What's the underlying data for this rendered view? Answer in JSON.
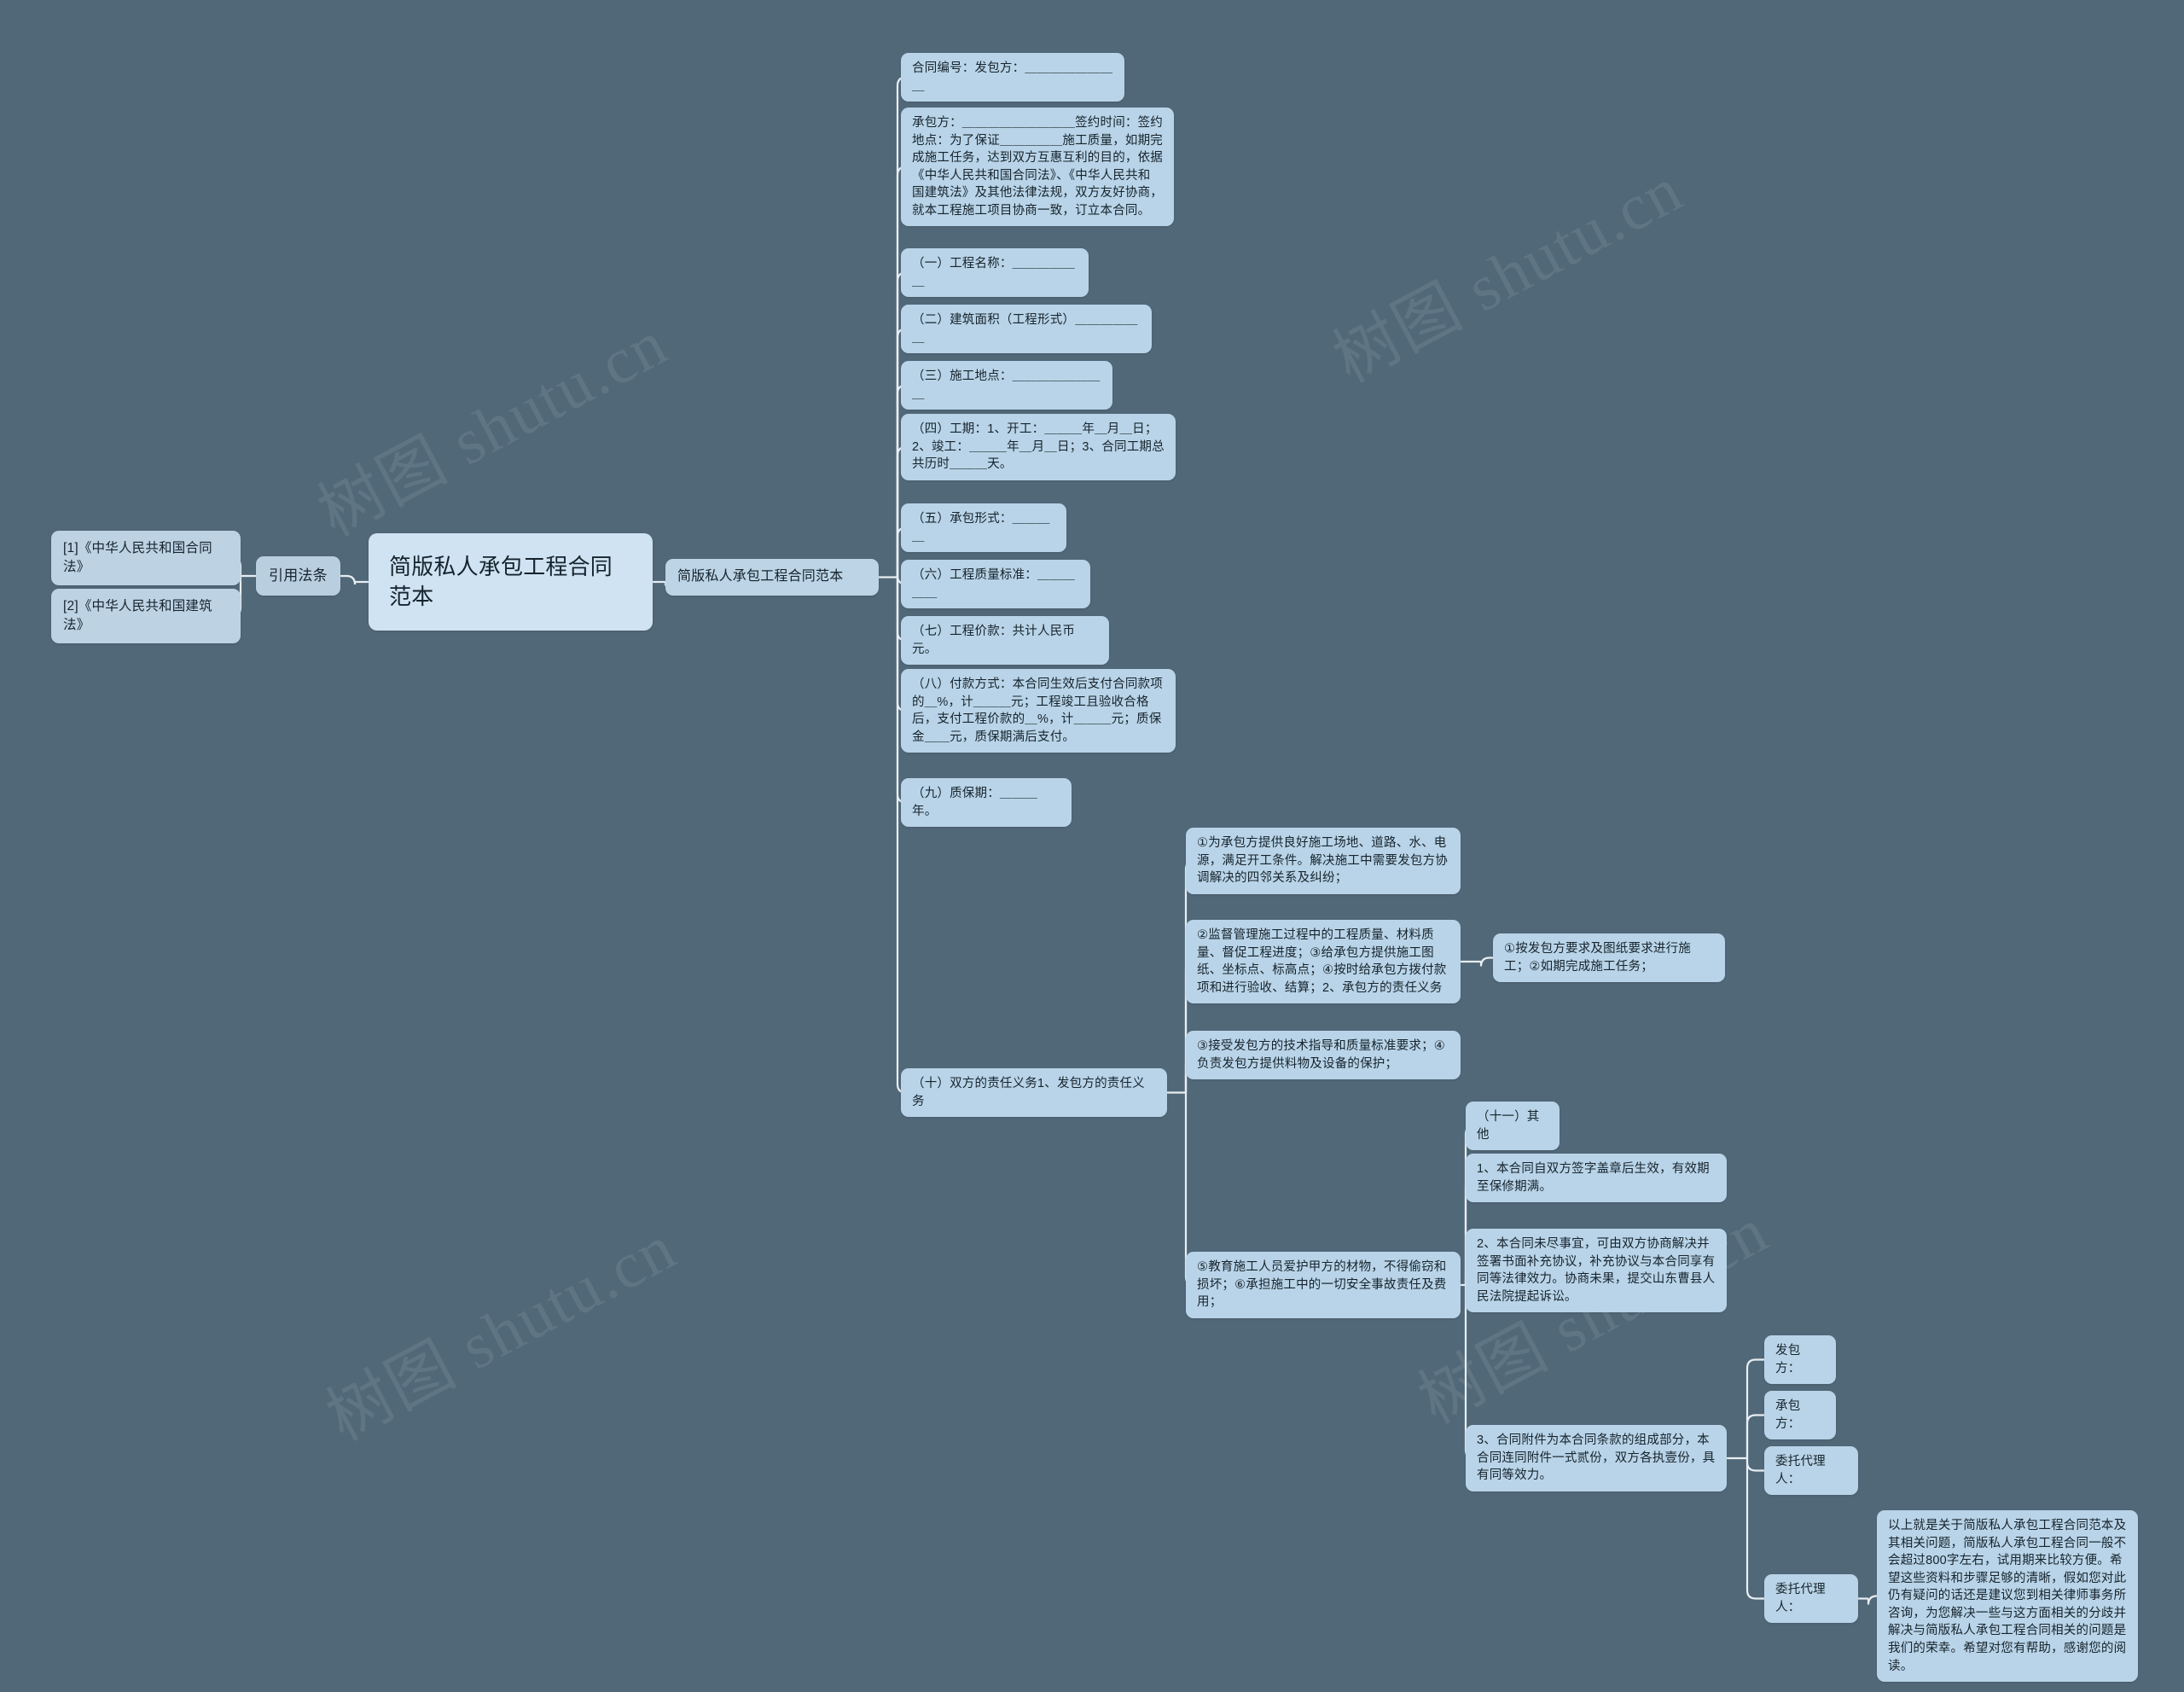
{
  "meta": {
    "background_color": "#516879",
    "node_color": "#b9d4e8",
    "root_node_color": "#cfe3f2",
    "link_color": "#e8eef2",
    "text_color": "#16232c",
    "watermark_text": "树图 shutu.cn"
  },
  "root": {
    "label": "简版私人承包工程合同范本"
  },
  "left_branch": {
    "label": "引用法条",
    "references": [
      {
        "label": "[1]《中华人民共和国合同法》"
      },
      {
        "label": "[2]《中华人民共和国建筑法》"
      }
    ]
  },
  "main_branch": {
    "label": "简版私人承包工程合同范本",
    "clauses": [
      {
        "id": "c0",
        "label": "合同编号：发包方：＿＿＿＿＿＿＿＿"
      },
      {
        "id": "c1",
        "label": "承包方：＿＿＿＿＿＿＿＿＿签约时间：签约地点：为了保证＿＿＿＿＿施工质量，如期完成施工任务，达到双方互惠互利的目的，依据《中华人民共和国合同法》、《中华人民共和国建筑法》及其他法律法规，双方友好协商，就本工程施工项目协商一致，订立本合同。"
      },
      {
        "id": "c2",
        "label": "（一）工程名称：＿＿＿＿＿＿"
      },
      {
        "id": "c3",
        "label": "（二）建筑面积（工程形式）＿＿＿＿＿＿"
      },
      {
        "id": "c4",
        "label": "（三）施工地点：＿＿＿＿＿＿＿＿"
      },
      {
        "id": "c5",
        "label": "（四）工期：1、开工：＿＿＿年＿月＿日；2、竣工：＿＿＿年＿月＿日；3、合同工期总共历时＿＿＿天。"
      },
      {
        "id": "c6",
        "label": "（五）承包形式：＿＿＿＿"
      },
      {
        "id": "c7",
        "label": "（六）工程质量标准：＿＿＿＿＿"
      },
      {
        "id": "c8",
        "label": "（七）工程价款：共计人民币元。"
      },
      {
        "id": "c9",
        "label": "（八）付款方式：本合同生效后支付合同款项的＿%，计＿＿＿元；工程竣工且验收合格后，支付工程价款的＿%，计＿＿＿元；质保金＿＿元，质保期满后支付。"
      },
      {
        "id": "c10",
        "label": "（九）质保期：＿＿＿年。"
      },
      {
        "id": "c11",
        "label": "（十）双方的责任义务1、发包方的责任义务"
      }
    ]
  },
  "duties_branch": {
    "items": [
      {
        "id": "d0",
        "label": "①为承包方提供良好施工场地、道路、水、电源，满足开工条件。解决施工中需要发包方协调解决的四邻关系及纠纷；"
      },
      {
        "id": "d1",
        "label": "②监督管理施工过程中的工程质量、材料质量、督促工程进度；③给承包方提供施工图纸、坐标点、标高点；④按时给承包方拨付款项和进行验收、结算；2、承包方的责任义务"
      },
      {
        "id": "d2",
        "label": "③接受发包方的技术指导和质量标准要求；④负责发包方提供料物及设备的保护；"
      },
      {
        "id": "d3",
        "label": "⑤教育施工人员爱护甲方的材物，不得偷窃和损坏；⑥承担施工中的一切安全事故责任及费用；"
      }
    ]
  },
  "contractor_duties": {
    "label": "①按发包方要求及图纸要求进行施工；②如期完成施工任务；"
  },
  "other_branch": {
    "items": [
      {
        "id": "o0",
        "label": "（十一）其他"
      },
      {
        "id": "o1",
        "label": "1、本合同自双方签字盖章后生效，有效期至保修期满。"
      },
      {
        "id": "o2",
        "label": "2、本合同未尽事宜，可由双方协商解决并签署书面补充协议，补充协议与本合同享有同等法律效力。协商未果，提交山东曹县人民法院提起诉讼。"
      },
      {
        "id": "o3",
        "label": "3、合同附件为本合同条款的组成部分，本合同连同附件一式贰份，双方各执壹份，具有同等效力。"
      }
    ]
  },
  "signatures": {
    "items": [
      {
        "id": "s0",
        "label": "发包方："
      },
      {
        "id": "s1",
        "label": "承包方："
      },
      {
        "id": "s2",
        "label": "委托代理人："
      },
      {
        "id": "s3",
        "label": "委托代理人："
      }
    ]
  },
  "closing": {
    "label": "以上就是关于简版私人承包工程合同范本及其相关问题，简版私人承包工程合同一般不会超过800字左右，试用期来比较方便。希望这些资料和步骤足够的清晰，假如您对此仍有疑问的话还是建议您到相关律师事务所咨询，为您解决一些与这方面相关的分歧并解决与简版私人承包工程合同相关的问题是我们的荣幸。希望对您有帮助，感谢您的阅读。"
  }
}
